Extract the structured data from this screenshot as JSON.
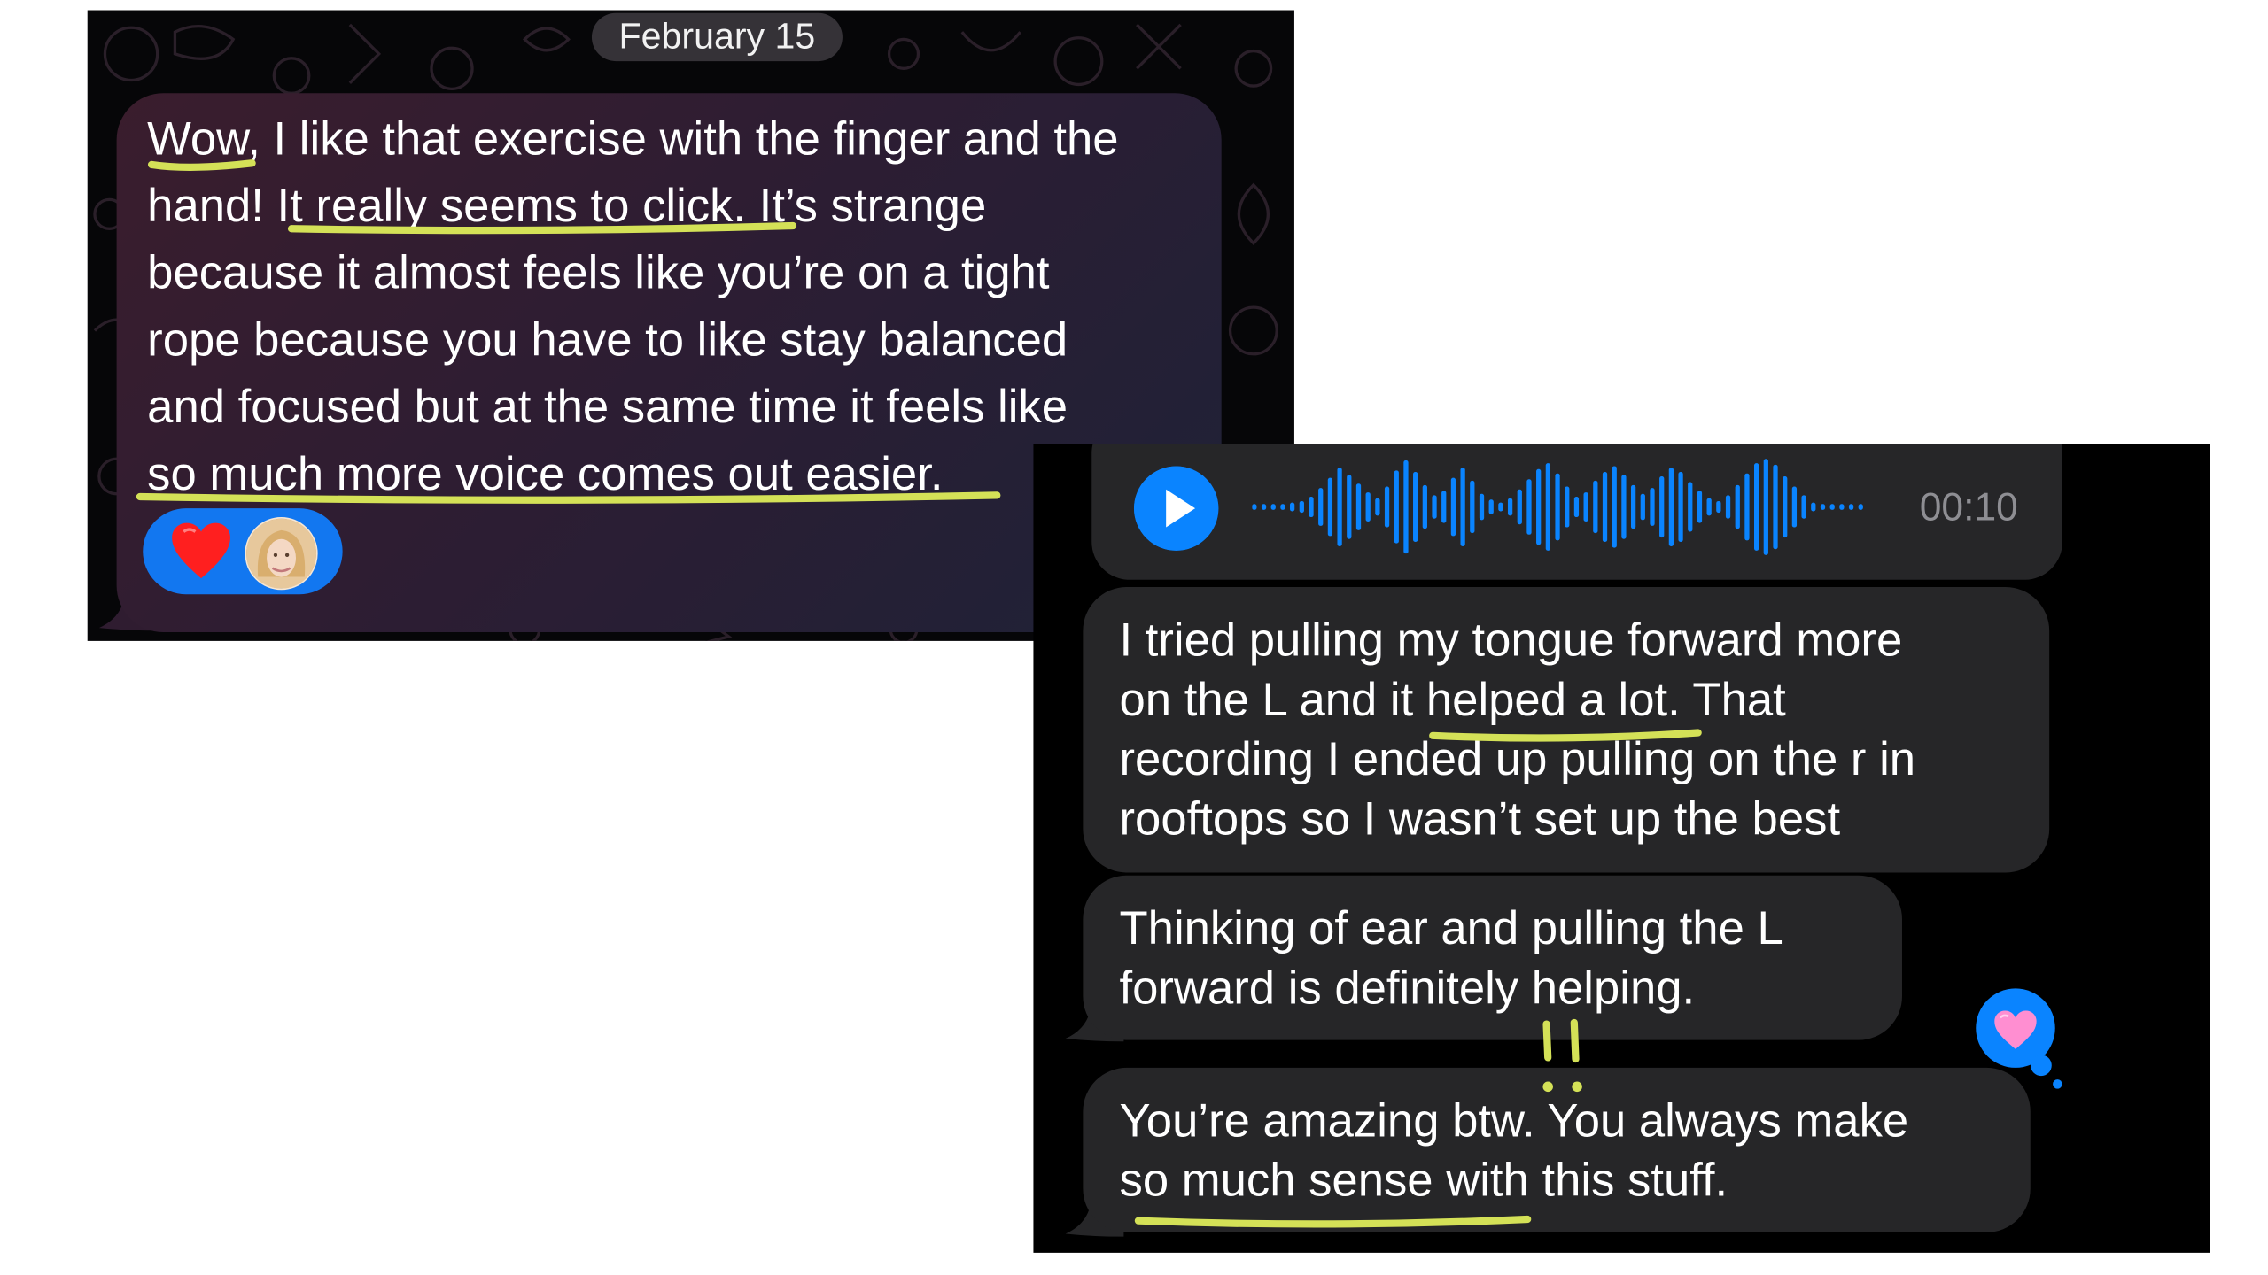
{
  "left_chat": {
    "date": "February 15",
    "message_lines": [
      "Wow, I like that exercise with the finger and the",
      "hand! It really seems to click. It’s strange",
      "because it almost feels like you’re on a tight",
      "rope because you have to like stay balanced",
      "and focused but at the same time it feels like",
      "so much more voice comes out easier."
    ],
    "reactions": [
      "heart-icon",
      "avatar"
    ]
  },
  "right_chat": {
    "voice_message": {
      "duration": "00:10",
      "play_icon": "play-icon"
    },
    "messages": [
      {
        "lines": [
          "I tried pulling my tongue forward more",
          "on the L and it helped a lot. That",
          "recording I ended up pulling on the r in",
          "rooftops so I wasn’t set up the best"
        ]
      },
      {
        "lines": [
          "Thinking of ear and pulling the L",
          "forward is definitely helping."
        ]
      },
      {
        "lines": [
          "You’re amazing btw. You always make",
          "so much sense with this stuff."
        ]
      }
    ],
    "reaction": "pink-heart-icon"
  },
  "colors": {
    "highlighter": "#d4e157",
    "ios_blue": "#0a84ff",
    "bubble_gray": "#262628"
  }
}
